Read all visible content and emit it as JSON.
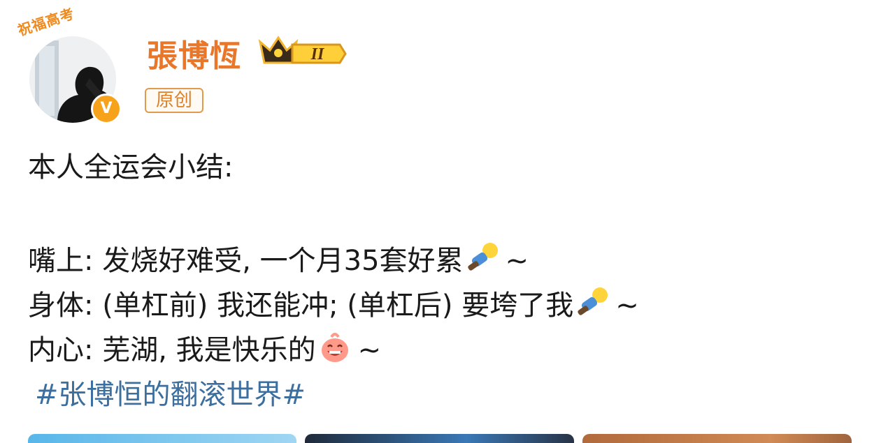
{
  "header": {
    "avatar_frame_text": "祝福高考",
    "username": "張博恆",
    "member_level": "II",
    "original_tag": "原创"
  },
  "post": {
    "line_1": "本人全运会小结:",
    "line_2": "嘴上: 发烧好难受, 一个月35套好累",
    "line_3": "身体: (单杠前) 我还能冲; (单杠后) 要垮了我",
    "line_4": "内心: 芜湖, 我是快乐的",
    "tilde": "~",
    "hashtag": "#张博恒的翻滚世界#"
  },
  "icons": {
    "verified": "verified-v-badge-icon",
    "member": "crown-member-badge-icon",
    "emoji_tired": "lying-down-doll-emoji-icon",
    "emoji_happy": "happy-laughing-emoji-icon"
  },
  "colors": {
    "username": "#e8772a",
    "hashtag": "#3c6e9e",
    "tag_border": "#e09a4a",
    "verified": "#f7a21b"
  }
}
